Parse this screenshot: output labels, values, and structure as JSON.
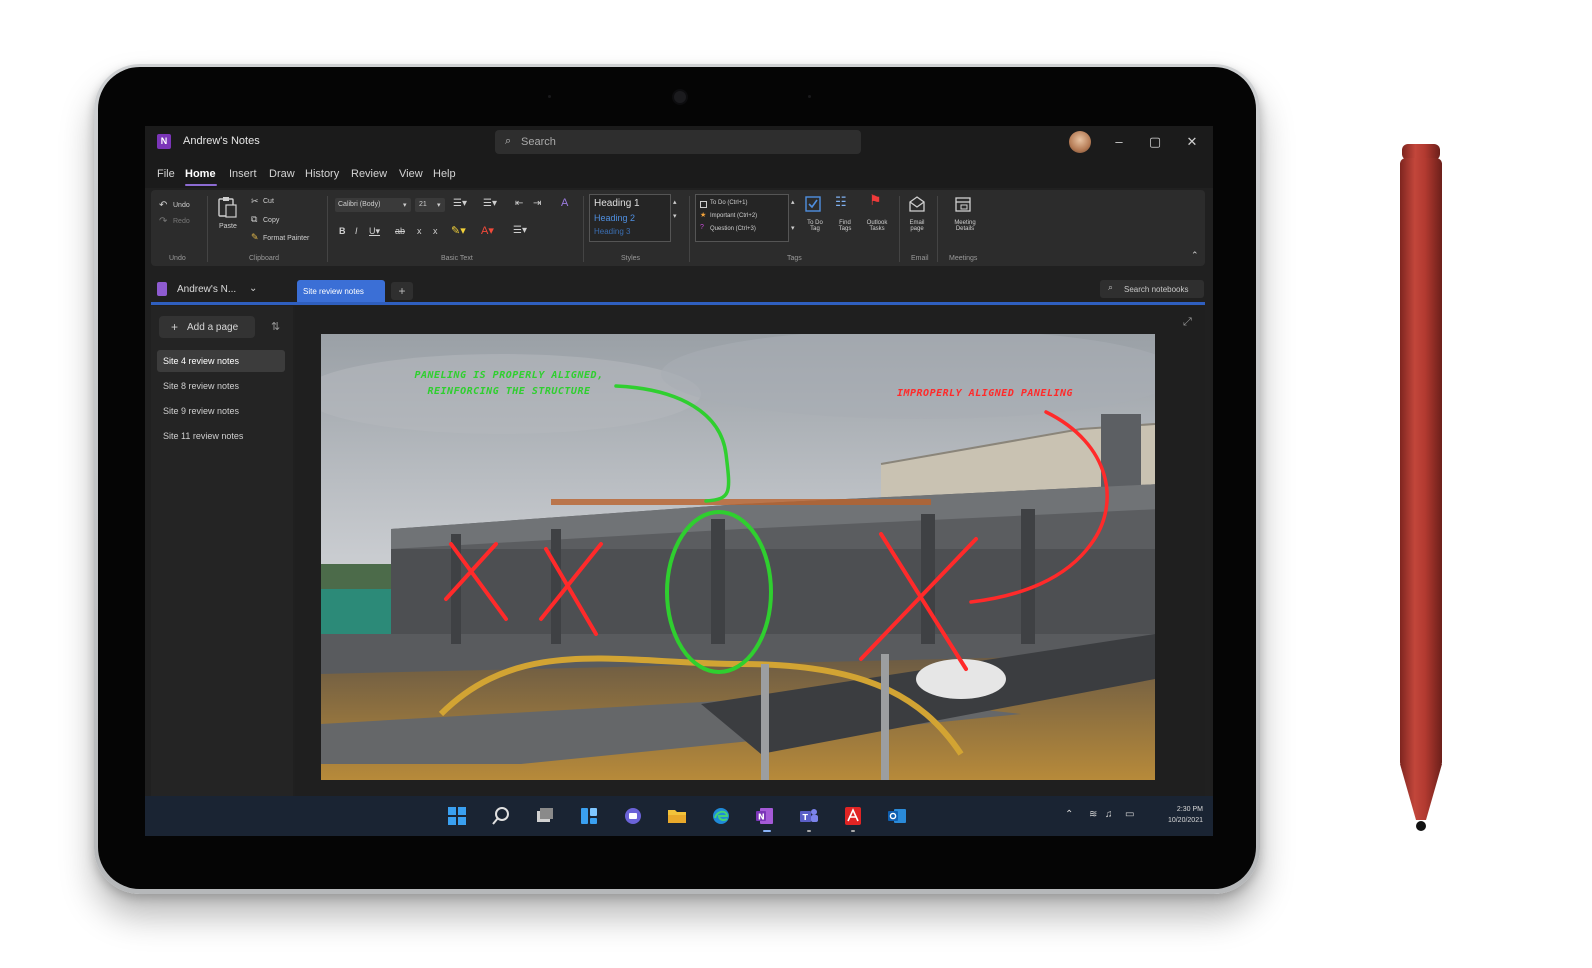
{
  "app": {
    "title": "Andrew's Notes",
    "search_placeholder": "Search",
    "window_controls": [
      "–",
      "▢",
      "✕"
    ]
  },
  "menu": {
    "items": [
      "File",
      "Home",
      "Insert",
      "Draw",
      "History",
      "Review",
      "View",
      "Help"
    ],
    "active": "Home"
  },
  "ribbon": {
    "undo": "Undo",
    "redo": "Redo",
    "paste": "Paste",
    "cut": "Cut",
    "copy": "Copy",
    "format_painter": "Format Painter",
    "font_name": "Calibri (Body)",
    "font_size": "21",
    "styles": [
      "Heading 1",
      "Heading 2",
      "Heading 3"
    ],
    "tags": [
      "To Do (Ctrl+1)",
      "Important (Ctrl+2)",
      "Question (Ctrl+3)"
    ],
    "todo_tag": "To Do Tag",
    "find_tags": "Find Tags",
    "outlook_tasks": "Outlook Tasks",
    "email_page": "Email page",
    "meeting_details": "Meeting Details",
    "group_labels": [
      "Undo",
      "Clipboard",
      "Basic Text",
      "Styles",
      "Tags",
      "Email",
      "Meetings"
    ],
    "collapse_icon": "chevron-up-icon"
  },
  "notebook": {
    "name": "Andrew's N...",
    "section_tab": "Site review notes",
    "add_tab": "+",
    "search_notebooks": "Search notebooks"
  },
  "pages": {
    "add_page": "Add a page",
    "items": [
      "Site 4 review notes",
      "Site 8 review notes",
      "Site 9 review notes",
      "Site 11 review notes"
    ],
    "selected": 0
  },
  "annotations": {
    "green": "PANELING IS PROPERLY ALIGNED, REINFORCING THE STRUCTURE",
    "red": "IMPROPERLY ALIGNED PANELING"
  },
  "taskbar": {
    "icons": [
      "windows-start-icon",
      "search-icon",
      "task-view-icon",
      "widgets-icon",
      "chat-icon",
      "file-explorer-icon",
      "edge-icon",
      "onenote-icon",
      "teams-icon",
      "acrobat-icon",
      "outlook-icon"
    ],
    "time": "2:30 PM",
    "date": "10/20/2021"
  },
  "colors": {
    "accent": "#3b6fd6",
    "onenote_purple": "#7b35b8",
    "ink_green": "#2fcf2f",
    "ink_red": "#ff2a2a",
    "pen_red": "#b23a30"
  }
}
